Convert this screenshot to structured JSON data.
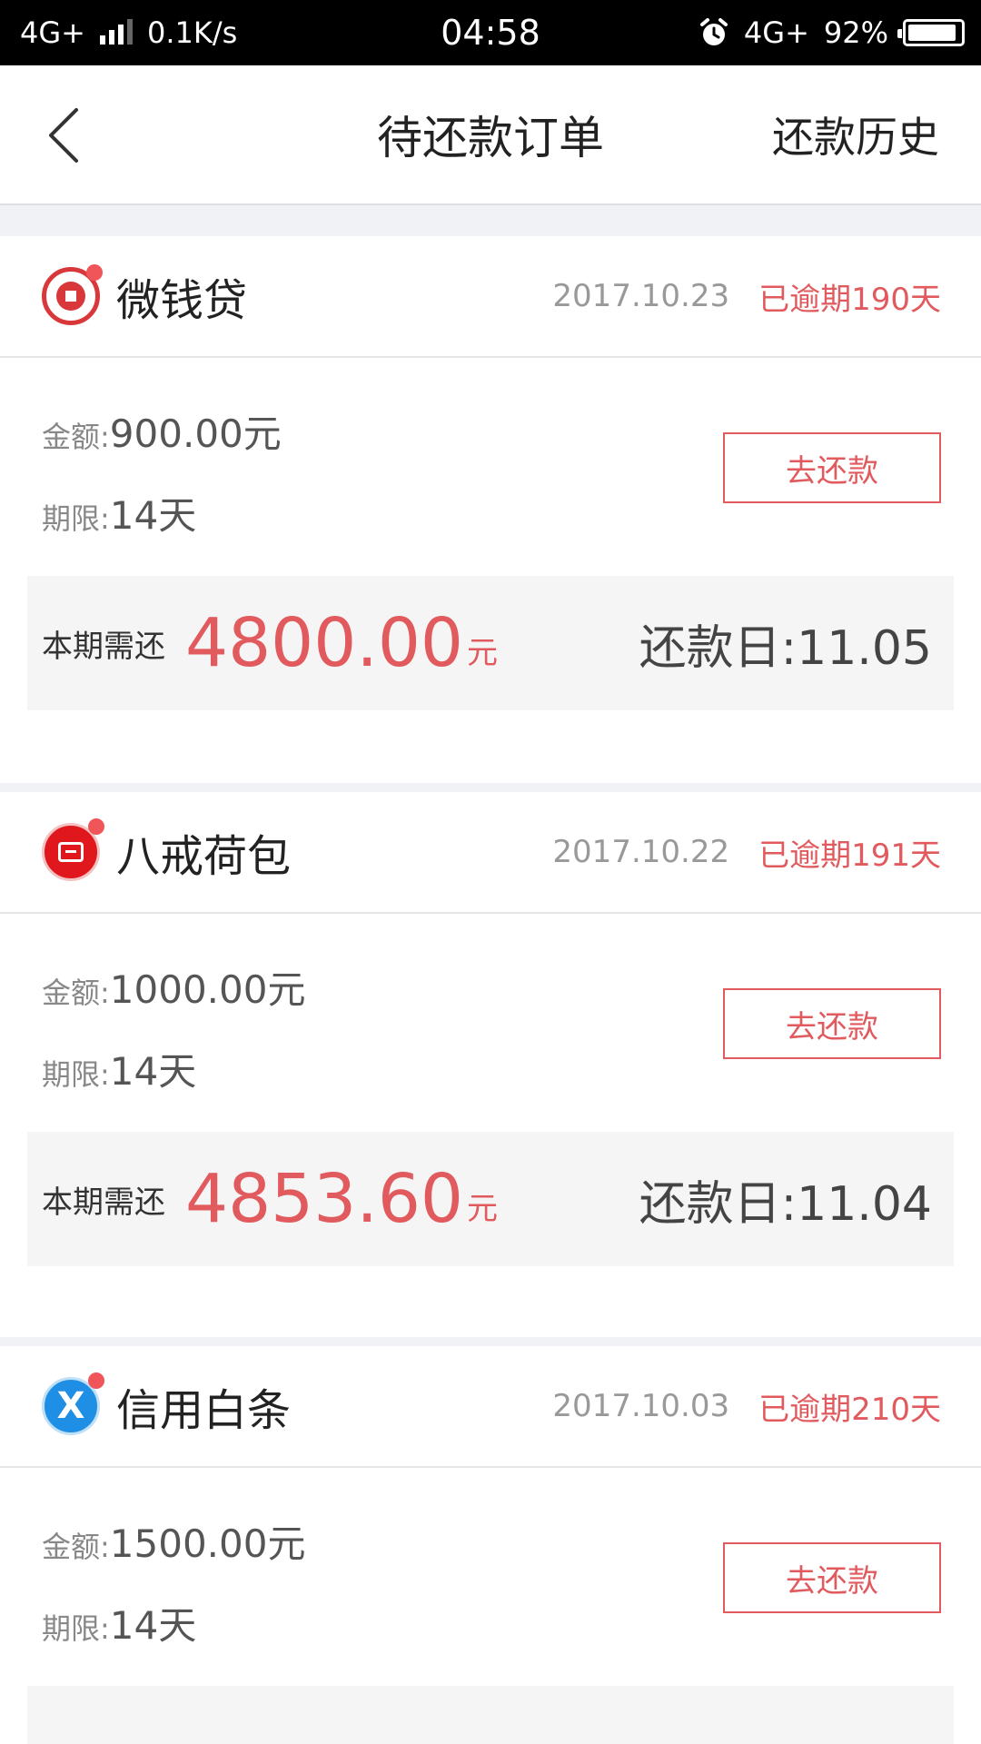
{
  "status_bar": {
    "network": "4G+",
    "speed": "0.1K/s",
    "time": "04:58",
    "network_right": "4G+",
    "battery": "92%",
    "battery_level": 0.92
  },
  "header": {
    "title": "待还款订单",
    "history_label": "还款历史"
  },
  "labels": {
    "amount": "金额:",
    "term": "期限:",
    "due_this_period": "本期需还",
    "unit": "元",
    "repay_button": "去还款",
    "repay_date_prefix": "还款日:"
  },
  "loans": [
    {
      "name": "微钱贷",
      "logo": "weiqiandai-logo",
      "date": "2017.10.23",
      "overdue": "已逾期190天",
      "amount": "900.00元",
      "term": "14天",
      "due_amount": "4800.00",
      "repay_date": "还款日:11.05"
    },
    {
      "name": "八戒荷包",
      "logo": "bajiehebao-logo",
      "date": "2017.10.22",
      "overdue": "已逾期191天",
      "amount": "1000.00元",
      "term": "14天",
      "due_amount": "4853.60",
      "repay_date": "还款日:11.04"
    },
    {
      "name": "信用白条",
      "logo": "xinyongbaitiao-logo",
      "logo_letter": "X",
      "date": "2017.10.03",
      "overdue": "已逾期210天",
      "amount": "1500.00元",
      "term": "14天"
    }
  ],
  "colors": {
    "accent": "#e05a5e",
    "background": "#f0f2f5",
    "due_box": "#f5f5f5"
  }
}
